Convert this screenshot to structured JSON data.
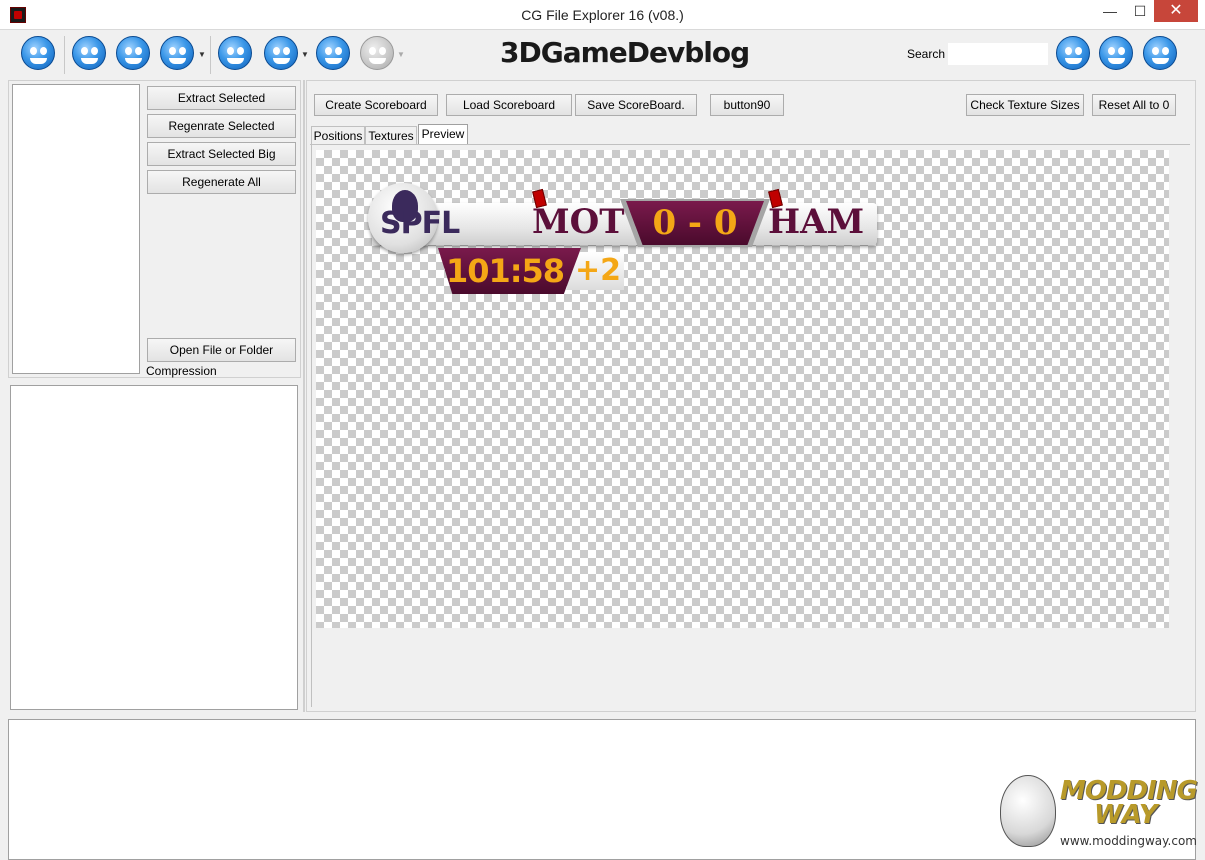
{
  "window": {
    "title": "CG File Explorer 16 (v08.)",
    "min_glyph": "—",
    "max_glyph": "☐",
    "close_glyph": "✕"
  },
  "toolbar": {
    "logo_text": "3DGameDevblog",
    "search_label": "Search",
    "search_value": "",
    "icons": [
      "smiley-icon",
      "scream-icon",
      "worried-icon",
      "cry-icon",
      "laugh-icon",
      "eye-icon",
      "grin-icon",
      "disabled-icon",
      "facepalm-icon",
      "sick-icon",
      "happy-icon"
    ]
  },
  "left": {
    "buttons": {
      "extract_selected": "Extract Selected",
      "regenerate_selected": "Regenrate Selected",
      "extract_selected_big": "Extract Selected Big",
      "regenerate_all": "Regenerate All",
      "open_file": "Open File or Folder"
    },
    "compression_label": "Compression"
  },
  "right": {
    "buttons": {
      "create_scoreboard": "Create Scoreboard",
      "load_scoreboard": "Load Scoreboard",
      "save_scoreboard": "Save ScoreBoard.",
      "button90": "button90",
      "check_texture_sizes": "Check Texture Sizes",
      "reset_all": "Reset All to 0"
    },
    "tabs": [
      {
        "label": "Positions",
        "active": false
      },
      {
        "label": "Textures",
        "active": false
      },
      {
        "label": "Preview",
        "active": true
      }
    ]
  },
  "scoreboard": {
    "league": "SPFL",
    "home_team": "MOT",
    "away_team": "HAM",
    "score": "0 - 0",
    "time": "101:58",
    "added_time": "+2",
    "colors": {
      "primary": "#5c0f3a",
      "accent": "#f4a716",
      "card": "#c00000"
    }
  },
  "watermark": {
    "line1": "MODDING",
    "line2": "WAY",
    "url": "www.moddingway.com"
  }
}
